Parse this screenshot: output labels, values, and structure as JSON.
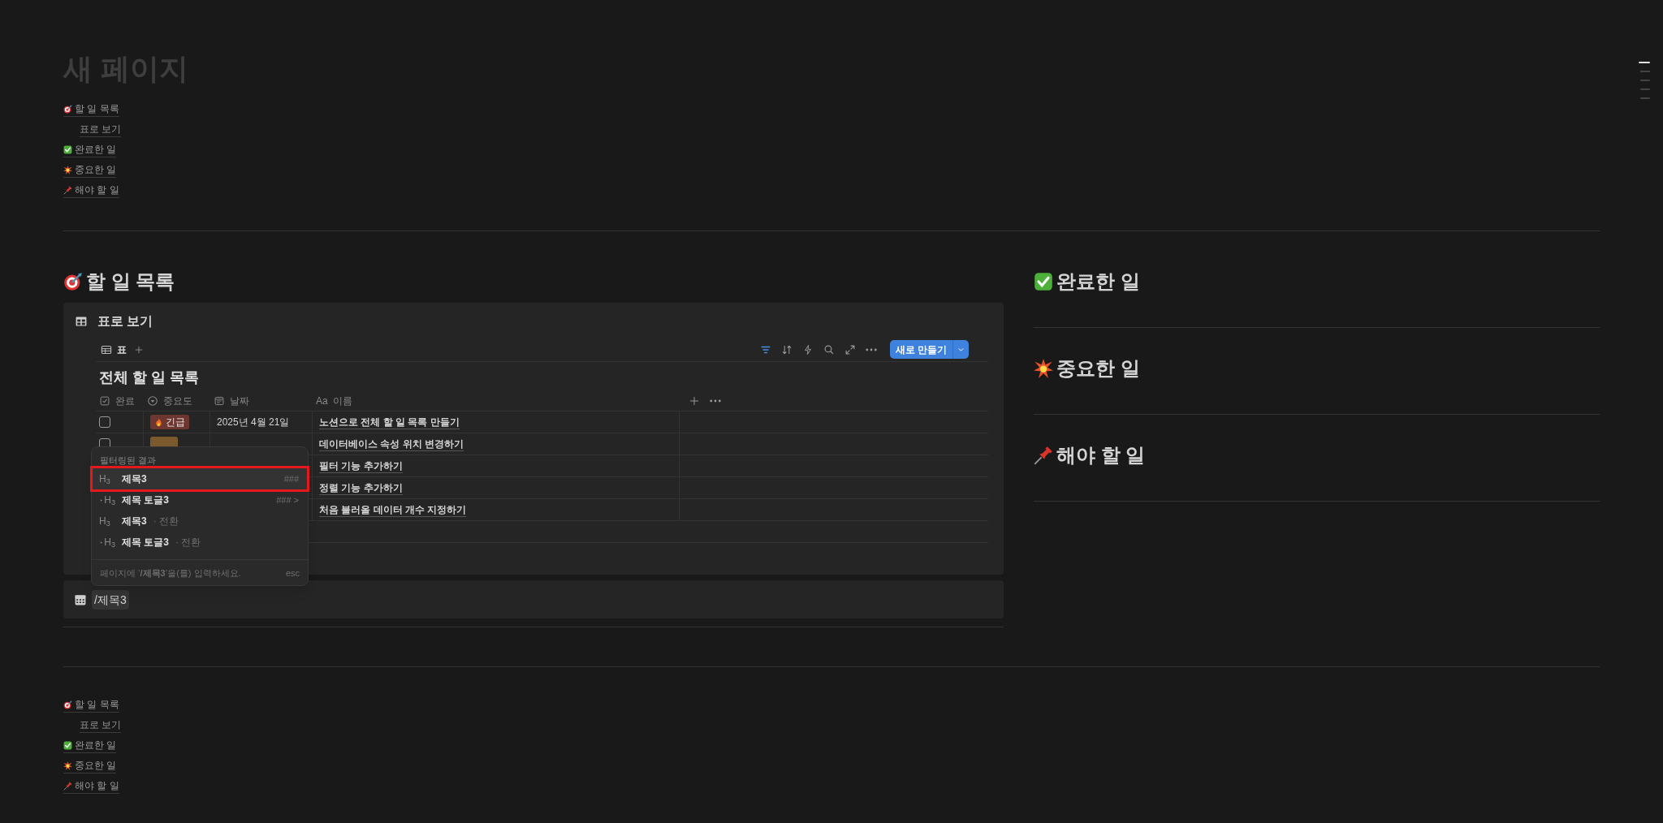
{
  "page": {
    "title": "새 페이지"
  },
  "toc_top": [
    {
      "kind": "target",
      "text": "할 일 목록",
      "children": [
        {
          "text": "표로 보기"
        }
      ]
    },
    {
      "kind": "check",
      "text": "완료한 일"
    },
    {
      "kind": "burst",
      "text": "중요한 일"
    },
    {
      "kind": "pin",
      "text": "해야 할 일"
    }
  ],
  "left_section": {
    "kind": "target",
    "heading": "할 일 목록",
    "database": {
      "title": "표로 보기",
      "views": [
        {
          "label": "표",
          "selected": true
        }
      ],
      "toolbar": [
        {
          "kind": "filter",
          "active": true
        },
        {
          "kind": "sort",
          "active": false
        },
        {
          "kind": "bolt",
          "active": false
        },
        {
          "kind": "search",
          "active": false
        },
        {
          "kind": "expand",
          "active": false
        },
        {
          "kind": "more",
          "active": false
        }
      ],
      "new_button": "새로 만들기",
      "table_title": "전체 할 일 목록",
      "columns": [
        {
          "kind": "checkbox",
          "label": "완료"
        },
        {
          "kind": "select",
          "label": "중요도"
        },
        {
          "kind": "date",
          "label": "날짜"
        },
        {
          "kind": "title",
          "label": "Aa",
          "label2": "이름"
        }
      ],
      "rows": [
        {
          "done": false,
          "priority": {
            "kind": "fire",
            "label": "긴급",
            "color": "#6e3630"
          },
          "date": "2025년 4월 21일",
          "name": "노션으로 전체 할 일 목록 만들기"
        },
        {
          "done": false,
          "priority": {
            "color": "#7b5a2d"
          },
          "name": "데이터베이스 속성 위치 변경하기"
        },
        {
          "name": "필터 기능 추가하기"
        },
        {
          "name": "정렬 기능 추가하기"
        },
        {
          "name": "처음 불러올 데이터 개수 지정하기"
        }
      ]
    },
    "second_block": {
      "kind": "calendar",
      "text": "/제목3"
    }
  },
  "popup": {
    "label": "필터링된 결과",
    "items": [
      {
        "kind": "heading",
        "icon": "H$_{3}$",
        "text": "제목3",
        "shortcut": "###",
        "selected": true
      },
      {
        "kind": "toggle",
        "icon": "H$_{3}$",
        "text": "제목 토글3",
        "shortcut": "### >",
        "selected": false
      },
      {
        "kind": "heading",
        "icon": "H$_{3}$",
        "text": "제목3",
        "hint": "· 전환",
        "selected": false
      },
      {
        "kind": "toggle",
        "icon": "H$_{3}$",
        "text": "제목 토글3",
        "hint": "· 전환",
        "selected": false
      }
    ],
    "footer": "페이지에 ‘**/제목3**’을(를) 입력하세요.",
    "footer_key": "esc"
  },
  "right_sections": [
    {
      "kind": "check",
      "heading": "완료한 일"
    },
    {
      "kind": "burst",
      "heading": "중요한 일"
    },
    {
      "kind": "pin",
      "heading": "해야 할 일"
    }
  ],
  "toc_bottom": [
    {
      "kind": "target",
      "text": "할 일 목록",
      "children": [
        {
          "text": "표로 보기"
        }
      ]
    },
    {
      "kind": "check",
      "text": "완료한 일"
    },
    {
      "kind": "burst",
      "text": "중요한 일"
    },
    {
      "kind": "pin",
      "text": "해야 할 일"
    }
  ],
  "outline_marks": [
    {
      "selected": true
    },
    {
      "selected": false
    },
    {
      "selected": false
    },
    {
      "selected": false
    },
    {
      "selected": false
    }
  ]
}
